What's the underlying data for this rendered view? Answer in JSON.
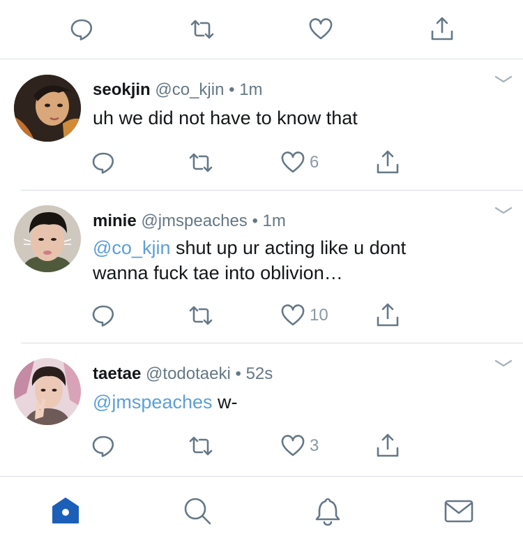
{
  "tweets": [
    {
      "name": "seokjin",
      "handle": "@co_kjin",
      "separator": "•",
      "time": "1m",
      "mention": "",
      "text": "uh we did not have to know that",
      "text_line2": "",
      "like_count": "6"
    },
    {
      "name": "minie",
      "handle": "@jmspeaches",
      "separator": "•",
      "time": "1m",
      "mention": "@co_kjin",
      "text": " shut up ur acting like u dont",
      "text_line2": "wanna fuck tae into oblivion…",
      "like_count": "10"
    },
    {
      "name": "taetae",
      "handle": "@todotaeki",
      "separator": "•",
      "time": "52s",
      "mention": "@jmspeaches",
      "text": " w-",
      "text_line2": "",
      "like_count": "3"
    }
  ],
  "icons": {
    "reply": "reply-icon",
    "retweet": "retweet-icon",
    "like": "heart-icon",
    "share": "share-icon",
    "caret": "chevron-down-icon",
    "home": "home-icon",
    "search": "search-icon",
    "notifications": "bell-icon",
    "messages": "mail-icon"
  },
  "colors": {
    "accent": "#1da1f2",
    "mention": "#5b9fd9",
    "icon_gray": "#657786",
    "home_active": "#1c5fb8"
  }
}
